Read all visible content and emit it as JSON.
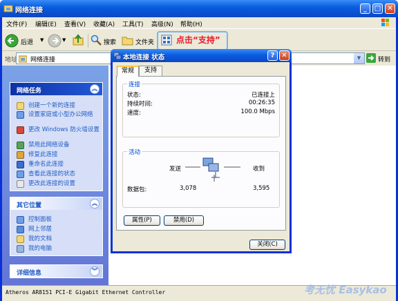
{
  "window": {
    "title": "网络连接"
  },
  "menu": [
    "文件(F)",
    "编辑(E)",
    "查看(V)",
    "收藏(A)",
    "工具(T)",
    "高级(N)",
    "帮助(H)"
  ],
  "toolbar": {
    "back": "后退",
    "search": "搜索",
    "folders": "文件夹",
    "hint": "点击“支持”"
  },
  "address": {
    "label": "地址(D)",
    "value": "网络连接",
    "go": "转到"
  },
  "left_panels": {
    "network_tasks": {
      "title": "网络任务",
      "items": [
        "创建一个新的连接",
        "设置家庭或小型办公网络",
        "更改 Windows 防火墙设置",
        "禁用此网络设备",
        "修复此连接",
        "重命名此连接",
        "查看此连接的状态",
        "更改此连接的设置"
      ]
    },
    "other_places": {
      "title": "其它位置",
      "items": [
        "控制面板",
        "网上邻居",
        "我的文档",
        "我的电脑"
      ]
    },
    "details": {
      "title": "详细信息"
    }
  },
  "statusbar": {
    "text": "Atheros AR8151 PCI-E Gigabit Ethernet Controller"
  },
  "watermark": "考无忧 Easykao",
  "dialog": {
    "title": "本地连接 状态",
    "tabs": [
      "常规",
      "支持"
    ],
    "connection": {
      "group": "连接",
      "status_label": "状态:",
      "status_value": "已连接上",
      "duration_label": "持续时间:",
      "duration_value": "00:26:35",
      "speed_label": "速度:",
      "speed_value": "100.0 Mbps"
    },
    "activity": {
      "group": "活动",
      "sent_label": "发送",
      "received_label": "收到",
      "packets_label": "数据包:",
      "sent_value": "3,078",
      "received_value": "3,595"
    },
    "buttons": {
      "properties": "属性(P)",
      "disable": "禁用(D)",
      "close": "关闭(C)"
    }
  },
  "colors": {
    "xp_blue": "#0831d9",
    "hint_red": "#e8182b",
    "task_link": "#215dc6"
  }
}
